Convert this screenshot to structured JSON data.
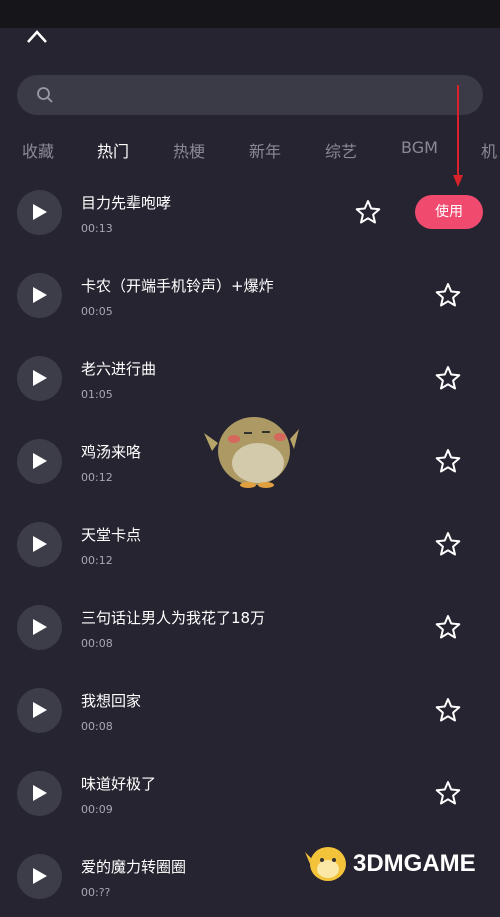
{
  "tabs": [
    "收藏",
    "热门",
    "热梗",
    "新年",
    "综艺",
    "BGM",
    "机"
  ],
  "active_tab": "热门",
  "use_button_label": "使用",
  "songs": [
    {
      "title": "目力先辈咆哮",
      "duration": "00:13"
    },
    {
      "title": "卡农（开端手机铃声）+爆炸",
      "duration": "00:05"
    },
    {
      "title": "老六进行曲",
      "duration": "01:05"
    },
    {
      "title": "鸡汤来咯",
      "duration": "00:12"
    },
    {
      "title": "天堂卡点",
      "duration": "00:12"
    },
    {
      "title": "三句话让男人为我花了18万",
      "duration": "00:08"
    },
    {
      "title": "我想回家",
      "duration": "00:08"
    },
    {
      "title": "味道好极了",
      "duration": "00:09"
    },
    {
      "title": "爱的魔力转圈圈",
      "duration": "00:??"
    }
  ],
  "watermark": "3DMGAME",
  "colors": {
    "background": "#252430",
    "accent": "#f04a6e",
    "annotation_arrow": "#d8232a"
  }
}
